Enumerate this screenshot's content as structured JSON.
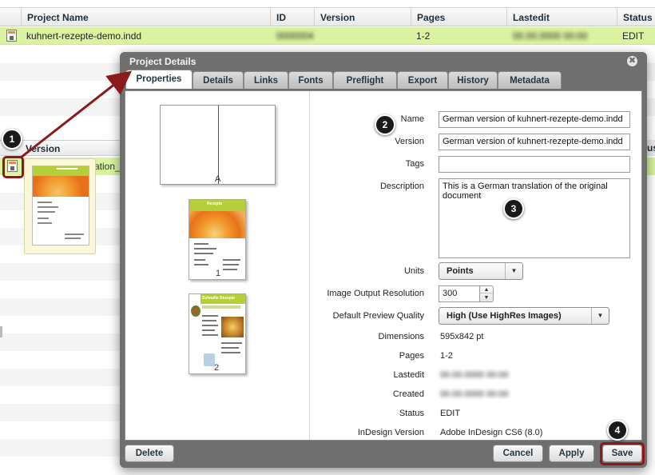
{
  "grid": {
    "columns": [
      "Project Name",
      "ID",
      "Version",
      "Pages",
      "Lastedit",
      "Status"
    ],
    "row": {
      "name": "kuhnert-rezepte-demo.indd",
      "id": "0000004",
      "version": "",
      "pages": "1-2",
      "lastedit": "00.00.0000 00:00",
      "status": "EDIT"
    },
    "versions_header": "Version",
    "versions_row_text": "ation_k",
    "versions_header_right": "us"
  },
  "dialog": {
    "title": "Project Details",
    "close_symbol": "✖",
    "tabs": [
      "Properties",
      "Details",
      "Links",
      "Fonts",
      "Preflight",
      "Export",
      "History",
      "Metadata"
    ],
    "active_tab": "Properties",
    "preview": {
      "spread_label": "A",
      "page1_label": "1",
      "page2_label": "2",
      "page1_heading": "Rezepte",
      "page2_heading": "Schnelle Rezepte"
    },
    "form": {
      "name_label": "Name",
      "name_value": "German version of kuhnert-rezepte-demo.indd",
      "version_label": "Version",
      "version_value": "German version of kuhnert-rezepte-demo.indd",
      "tags_label": "Tags",
      "tags_value": "",
      "description_label": "Description",
      "description_value": "This is a German translation of the original document",
      "units_label": "Units",
      "units_value": "Points",
      "resolution_label": "Image Output Resolution",
      "resolution_value": "300",
      "preview_quality_label": "Default Preview Quality",
      "preview_quality_value": "High (Use HighRes Images)",
      "dimensions_label": "Dimensions",
      "dimensions_value": "595x842 pt",
      "pages_label": "Pages",
      "pages_value": "1-2",
      "lastedit_label": "Lastedit",
      "lastedit_value": "00.00.0000 00:00",
      "created_label": "Created",
      "created_value": "00.00.0000 00:00",
      "status_label": "Status",
      "status_value": "EDIT",
      "indesign_label": "InDesign Version",
      "indesign_value": "Adobe InDesign CS6 (8.0)"
    },
    "buttons": {
      "delete": "Delete",
      "cancel": "Cancel",
      "apply": "Apply",
      "save": "Save"
    }
  },
  "annotations": {
    "m1": "1",
    "m2": "2",
    "m3": "3",
    "m4": "4",
    "highlight_color": "#8b1a1a"
  }
}
